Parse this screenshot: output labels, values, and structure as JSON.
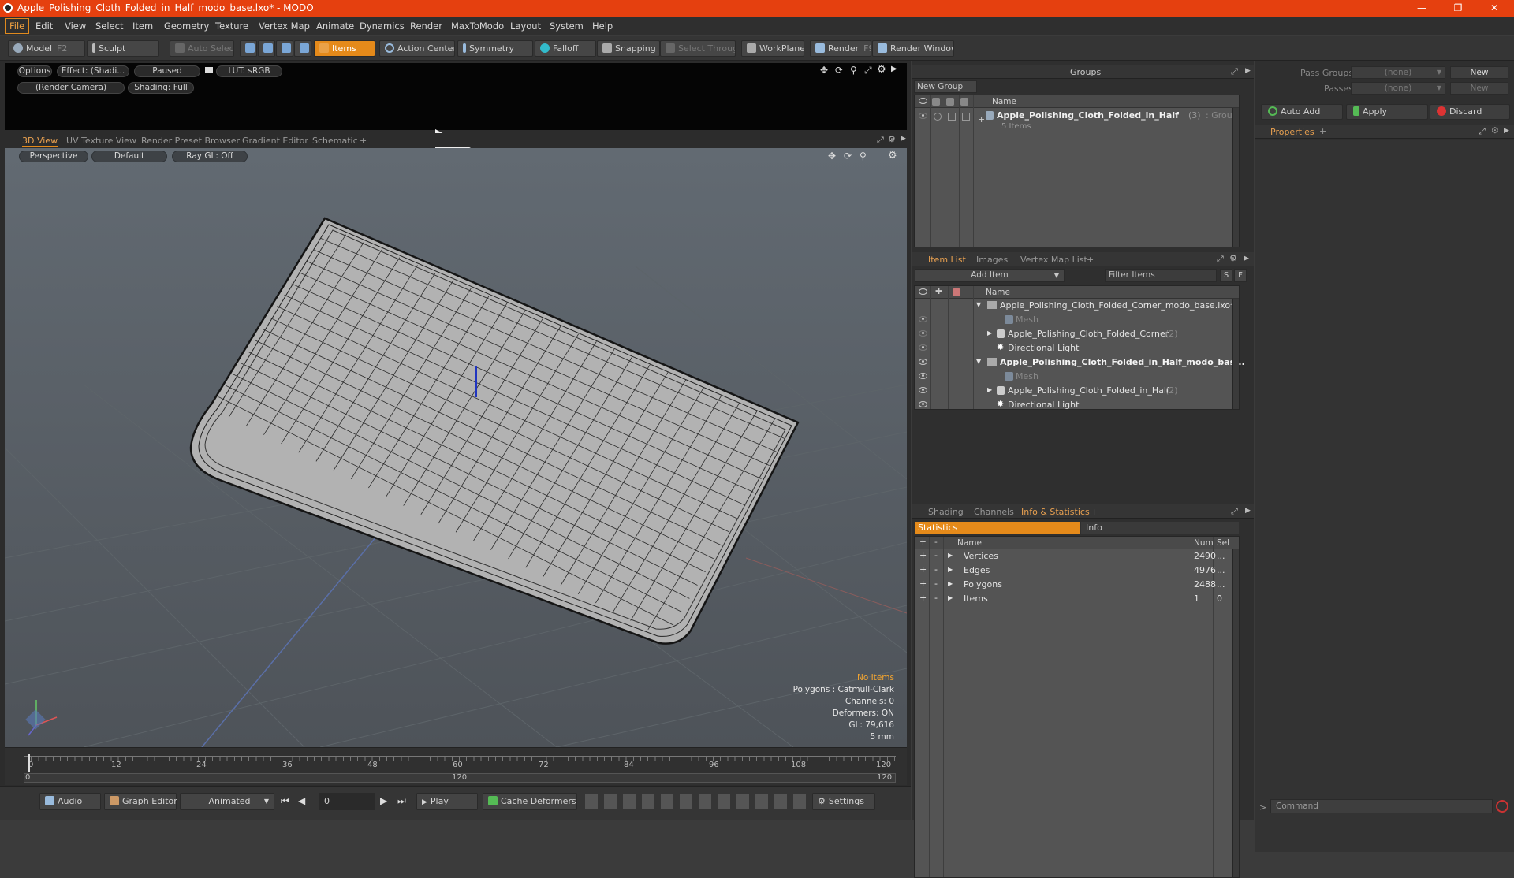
{
  "window": {
    "title": "Apple_Polishing_Cloth_Folded_in_Half_modo_base.lxo* - MODO"
  },
  "menu": [
    "File",
    "Edit",
    "View",
    "Select",
    "Item",
    "Geometry",
    "Texture",
    "Vertex Map",
    "Animate",
    "Dynamics",
    "Render",
    "MaxToModo",
    "Layout",
    "System",
    "Help"
  ],
  "toolbar": {
    "model": "Model",
    "model_key": "F2",
    "sculpt": "Sculpt",
    "auto_select": "Auto Select",
    "items": "Items",
    "action_center": "Action Center",
    "symmetry": "Symmetry",
    "falloff": "Falloff",
    "snapping": "Snapping",
    "select_through": "Select Through",
    "workplane": "WorkPlane",
    "render": "Render",
    "render_key": "F9",
    "render_window": "Render Window"
  },
  "preview": {
    "options": "Options",
    "effect": "Effect: (Shadi...",
    "paused": "Paused",
    "lut": "LUT: sRGB",
    "camera": "(Render Camera)",
    "shading": "Shading: Full"
  },
  "view_tabs": [
    "3D View",
    "UV Texture View",
    "Render Preset Browser",
    "Gradient Editor",
    "Schematic"
  ],
  "viewport": {
    "perspective": "Perspective",
    "default": "Default",
    "raygl": "Ray GL: Off",
    "stats": {
      "no_items": "No Items",
      "polygons": "Polygons : Catmull-Clark",
      "channels": "Channels: 0",
      "deformers": "Deformers: ON",
      "gl": "GL: 79,616",
      "unit": "5 mm"
    }
  },
  "timeline": {
    "ticks": [
      "0",
      "12",
      "24",
      "36",
      "48",
      "60",
      "72",
      "84",
      "96",
      "108",
      "120"
    ],
    "range_start": "0",
    "range_mid": "120",
    "range_end": "120"
  },
  "bottom": {
    "audio": "Audio",
    "graph_editor": "Graph Editor",
    "animated": "Animated",
    "frame": "0",
    "play": "Play",
    "cache_deformers": "Cache Deformers",
    "settings": "Settings"
  },
  "groups": {
    "title": "Groups",
    "new_group": "New Group",
    "col_name": "Name",
    "item_name": "Apple_Polishing_Cloth_Folded_in_Half",
    "item_count": "(3)",
    "item_type": ": Group",
    "item_sub": "5 Items"
  },
  "item_list": {
    "tabs": [
      "Item List",
      "Images",
      "Vertex Map List"
    ],
    "add_item": "Add Item",
    "filter": "Filter Items",
    "s": "S",
    "f": "F",
    "col_name": "Name",
    "rows": [
      {
        "name": "Apple_Polishing_Cloth_Folded_Corner_modo_base.lxo*",
        "extra": ""
      },
      {
        "name": "Mesh",
        "extra": ""
      },
      {
        "name": "Apple_Polishing_Cloth_Folded_Corner",
        "extra": "(2)"
      },
      {
        "name": "Directional Light",
        "extra": ""
      },
      {
        "name": "Apple_Polishing_Cloth_Folded_in_Half_modo_bas...",
        "extra": ""
      },
      {
        "name": "Mesh",
        "extra": ""
      },
      {
        "name": "Apple_Polishing_Cloth_Folded_in_Half",
        "extra": "(2)"
      },
      {
        "name": "Directional Light",
        "extra": ""
      }
    ]
  },
  "info": {
    "tabs": [
      "Shading",
      "Channels",
      "Info & Statistics"
    ],
    "statistics": "Statistics",
    "info": "Info",
    "col_name": "Name",
    "col_num": "Num",
    "col_sel": "Sel",
    "rows": [
      {
        "name": "Vertices",
        "num": "2490",
        "sel": "..."
      },
      {
        "name": "Edges",
        "num": "4976",
        "sel": "..."
      },
      {
        "name": "Polygons",
        "num": "2488",
        "sel": "..."
      },
      {
        "name": "Items",
        "num": "1",
        "sel": "0"
      }
    ]
  },
  "right": {
    "pass_groups": "Pass Groups",
    "passes": "Passes",
    "none": "(none)",
    "new": "New",
    "auto_add": "Auto Add",
    "apply": "Apply",
    "discard": "Discard",
    "properties": "Properties",
    "command": "Command"
  }
}
